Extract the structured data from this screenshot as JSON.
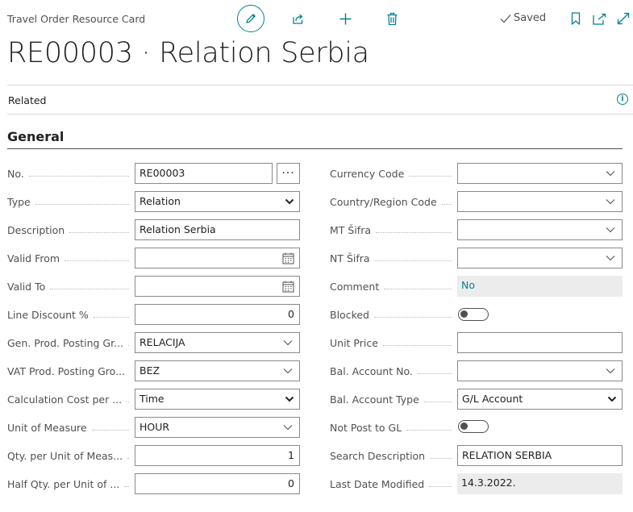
{
  "header": {
    "page_type": "Travel Order Resource Card",
    "title": "RE00003 · Relation Serbia",
    "saved_label": "Saved"
  },
  "related_label": "Related",
  "section_title": "General",
  "left_fields": {
    "no": {
      "label": "No.",
      "value": "RE00003"
    },
    "type": {
      "label": "Type",
      "value": "Relation"
    },
    "description": {
      "label": "Description",
      "value": "Relation Serbia"
    },
    "valid_from": {
      "label": "Valid From",
      "value": ""
    },
    "valid_to": {
      "label": "Valid To",
      "value": ""
    },
    "line_discount": {
      "label": "Line Discount %",
      "value": "0"
    },
    "gen_prod": {
      "label": "Gen. Prod. Posting Gr...",
      "value": "RELACIJA"
    },
    "vat_prod": {
      "label": "VAT Prod. Posting Gro...",
      "value": "BEZ"
    },
    "calc_cost": {
      "label": "Calculation Cost per ...",
      "value": "Time"
    },
    "uom": {
      "label": "Unit of Measure",
      "value": "HOUR"
    },
    "qty_per_uom": {
      "label": "Qty. per Unit of Meas...",
      "value": "1"
    },
    "half_qty": {
      "label": "Half Qty. per Unit of ...",
      "value": "0"
    }
  },
  "right_fields": {
    "currency": {
      "label": "Currency Code",
      "value": ""
    },
    "country": {
      "label": "Country/Region Code",
      "value": ""
    },
    "mt_sifra": {
      "label": "MT Šifra",
      "value": ""
    },
    "nt_sifra": {
      "label": "NT Šifra",
      "value": ""
    },
    "comment": {
      "label": "Comment",
      "value": "No"
    },
    "blocked": {
      "label": "Blocked",
      "value": false
    },
    "unit_price": {
      "label": "Unit Price",
      "value": ""
    },
    "bal_acc_no": {
      "label": "Bal. Account No.",
      "value": ""
    },
    "bal_acc_type": {
      "label": "Bal. Account Type",
      "value": "G/L Account"
    },
    "not_post_gl": {
      "label": "Not Post to GL",
      "value": false
    },
    "search_desc": {
      "label": "Search Description",
      "value": "RELATION SERBIA"
    },
    "last_modified": {
      "label": "Last Date Modified",
      "value": "14.3.2022."
    }
  },
  "colors": {
    "accent": "#00838f",
    "text": "#212121",
    "label": "#505050",
    "readonly_bg": "#ececec"
  },
  "icons": [
    "edit-icon",
    "share-icon",
    "add-icon",
    "delete-icon",
    "check-icon",
    "bookmark-icon",
    "open-new-window-icon",
    "expand-icon",
    "info-icon",
    "lookup-ellipsis-icon",
    "calendar-icon",
    "chevron-down-icon"
  ]
}
